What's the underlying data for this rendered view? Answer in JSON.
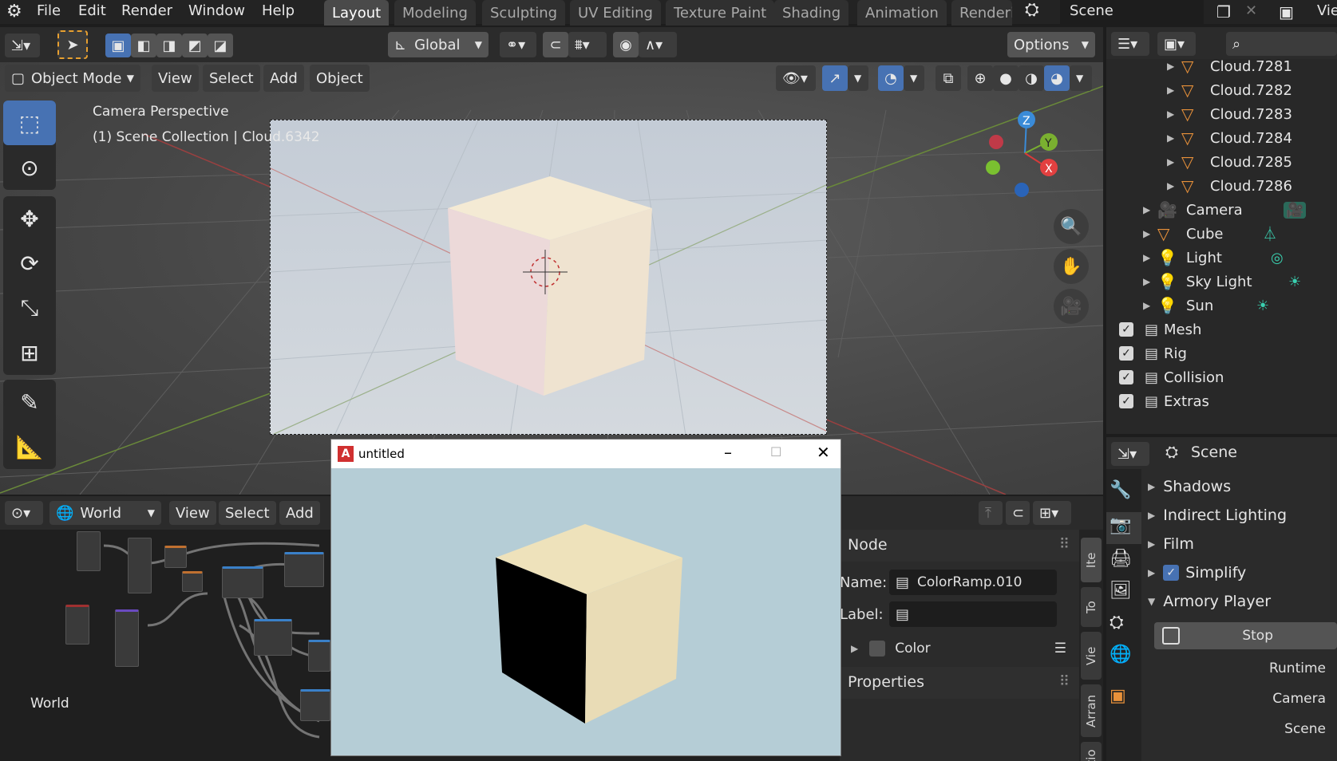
{
  "topbar": {
    "menus": [
      "File",
      "Edit",
      "Render",
      "Window",
      "Help"
    ],
    "workspaces": [
      "Layout",
      "Modeling",
      "Sculpting",
      "UV Editing",
      "Texture Paint",
      "Shading",
      "Animation",
      "Renderi"
    ],
    "active_workspace": "Layout",
    "scene_label": "Scene",
    "view_layer_label": "Vie"
  },
  "toolbar": {
    "orientation": "Global",
    "options_label": "Options"
  },
  "viewport": {
    "mode": "Object Mode",
    "menus": [
      "View",
      "Select",
      "Add",
      "Object"
    ],
    "overlay_title": "Camera Perspective",
    "overlay_subtitle": "(1) Scene Collection | Cloud.6342",
    "gizmo": {
      "z": "Z",
      "y": "Y",
      "x": "X"
    }
  },
  "outliner": {
    "rows": [
      {
        "label": "Cloud.7281",
        "type": "mesh",
        "indent": 2
      },
      {
        "label": "Cloud.7282",
        "type": "mesh",
        "indent": 2
      },
      {
        "label": "Cloud.7283",
        "type": "mesh",
        "indent": 2
      },
      {
        "label": "Cloud.7284",
        "type": "mesh",
        "indent": 2
      },
      {
        "label": "Cloud.7285",
        "type": "mesh",
        "indent": 2
      },
      {
        "label": "Cloud.7286",
        "type": "mesh",
        "indent": 2
      },
      {
        "label": "Camera",
        "type": "camera",
        "indent": 1
      },
      {
        "label": "Cube",
        "type": "mesh",
        "indent": 1
      },
      {
        "label": "Light",
        "type": "light",
        "indent": 1
      },
      {
        "label": "Sky Light",
        "type": "light",
        "indent": 1
      },
      {
        "label": "Sun",
        "type": "light",
        "indent": 1
      },
      {
        "label": "Mesh",
        "type": "collection",
        "indent": 0
      },
      {
        "label": "Rig",
        "type": "collection",
        "indent": 0
      },
      {
        "label": "Collision",
        "type": "collection",
        "indent": 0
      },
      {
        "label": "Extras",
        "type": "collection",
        "indent": 0
      }
    ]
  },
  "properties": {
    "context": "Scene",
    "panels": [
      "Shadows",
      "Indirect Lighting",
      "Film",
      "Simplify",
      "Armory Player"
    ],
    "stop_label": "Stop",
    "fields": [
      "Runtime",
      "Camera",
      "Scene"
    ]
  },
  "node_editor": {
    "world_label": "World",
    "menus": [
      "View",
      "Select",
      "Add"
    ],
    "corner_label": "World",
    "sidebar": {
      "node_header": "Node",
      "name_label": "Name:",
      "name_value": "ColorRamp.010",
      "label_label": "Label:",
      "color_label": "Color",
      "properties_header": "Properties"
    },
    "tabs": [
      "Ite",
      "To",
      "Vie",
      "Arran",
      "Optio"
    ]
  },
  "player_window": {
    "title": "untitled"
  },
  "colors": {
    "accent": "#4772b3",
    "mesh_orange": "#e8913a",
    "cube_face": "#eee2bb",
    "player_bg": "#b5cdd6"
  }
}
